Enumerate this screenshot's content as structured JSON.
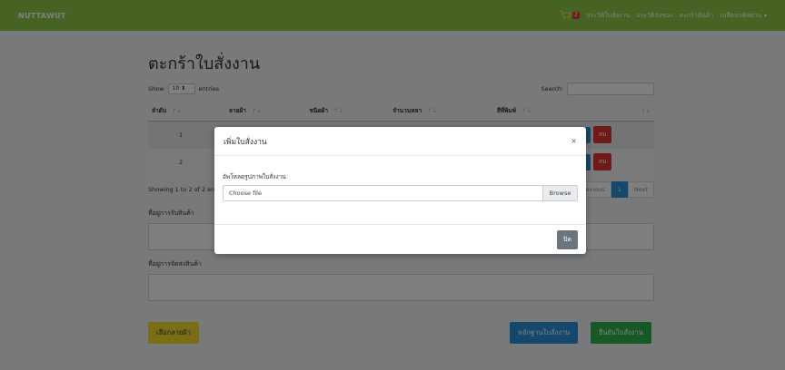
{
  "navbar": {
    "brand": "NUTTAWUT",
    "cart_count": "2",
    "links": [
      "ประวัติใบสั่งงาน",
      "ประวัติส่งของ",
      "ตะกร้าสินค้า",
      "เปลี่ยนรหัสผ่าน"
    ],
    "user_caret": "▾"
  },
  "page": {
    "title": "ตะกร้าใบสั่งงาน",
    "show_label": "Show",
    "show_value": "10",
    "entries_label": "entries",
    "search_label": "Search:"
  },
  "table": {
    "columns": [
      "ลำดับ",
      "ลายผ้า",
      "ชนิดผ้า",
      "จำนวนหลา",
      "สีที่พิมพ์",
      ""
    ],
    "rows": [
      {
        "no": "1",
        "delete_label": "ลบ"
      },
      {
        "no": "2",
        "delete_label": "ลบ"
      }
    ],
    "info": "Showing 1 to 2 of 2 entries",
    "previous": "Previous",
    "current_page": "1",
    "next": "Next"
  },
  "form": {
    "receive_label": "ที่อยู่การรับสินค้า",
    "ship_label": "ที่อยู่การจัดส่งสินค้า"
  },
  "buttons": {
    "select_pattern": "เลือกลายผ้า",
    "evidence": "หลักฐานใบสั่งงาน",
    "confirm": "ยืนยันใบสั่งงาน"
  },
  "modal": {
    "title": "เพิ่มใบสั่งงาน",
    "close_x": "×",
    "upload_label": "อัพโหลดรูปภาพใบสั่งงาน",
    "file_placeholder": "Choose file",
    "browse": "Browse",
    "close_button": "ปิด"
  },
  "colors": {
    "navbar": "#8fc748",
    "primary": "#2d8fd8",
    "danger": "#e53535",
    "success": "#2db34a",
    "warning": "#f5dd2a"
  }
}
